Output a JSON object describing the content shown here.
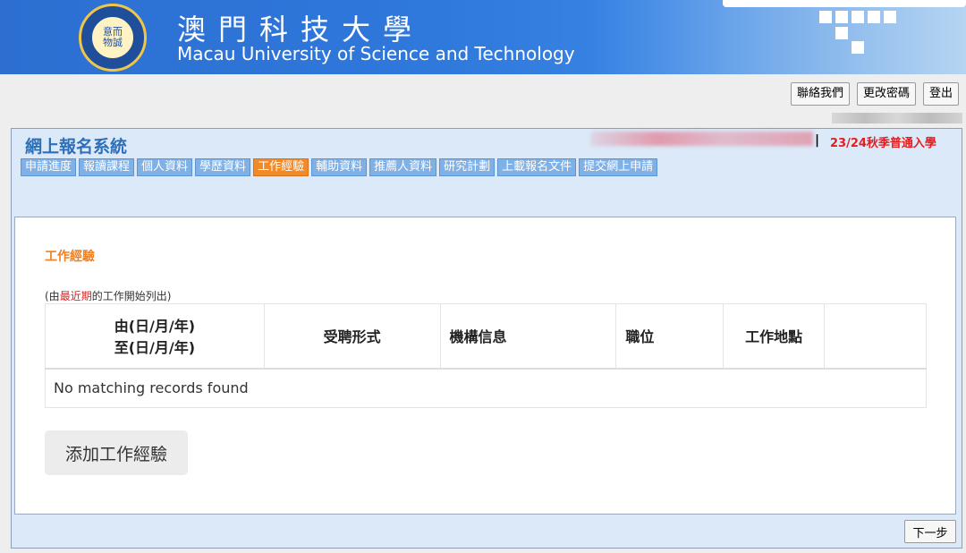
{
  "header": {
    "title_cn": "澳門科技大學",
    "title_en": "Macau University of Science and Technology",
    "logo_text": "意而\n物誠"
  },
  "top_links": [
    "聯絡我們",
    "更改密碼",
    "登出"
  ],
  "system": {
    "title": "網上報名系統",
    "intake": "23/24秋季普通入學",
    "intake_separator": "|"
  },
  "tabs": [
    {
      "label": "申請進度",
      "active": false
    },
    {
      "label": "報讀課程",
      "active": false
    },
    {
      "label": "個人資料",
      "active": false
    },
    {
      "label": "學歷資料",
      "active": false
    },
    {
      "label": "工作經驗",
      "active": true
    },
    {
      "label": "輔助資料",
      "active": false
    },
    {
      "label": "推薦人資料",
      "active": false
    },
    {
      "label": "研究計劃",
      "active": false
    },
    {
      "label": "上載報名文件",
      "active": false
    },
    {
      "label": "提交網上申請",
      "active": false
    }
  ],
  "work": {
    "section_title": "工作經驗",
    "note_prefix": "(由",
    "note_highlight": "最近期",
    "note_suffix": "的工作開始列出)",
    "columns": [
      "由(日/月/年)",
      "至(日/月/年)",
      "受聘形式",
      "機構信息",
      "職位",
      "工作地點",
      ""
    ],
    "empty_message": "No matching records found",
    "add_button": "添加工作經驗"
  },
  "footer": {
    "next_button": "下一步"
  },
  "colors": {
    "accent": "#f18a27",
    "tab": "#7fb0e6",
    "title_blue": "#2d6fb8",
    "red": "#e21f1f"
  }
}
